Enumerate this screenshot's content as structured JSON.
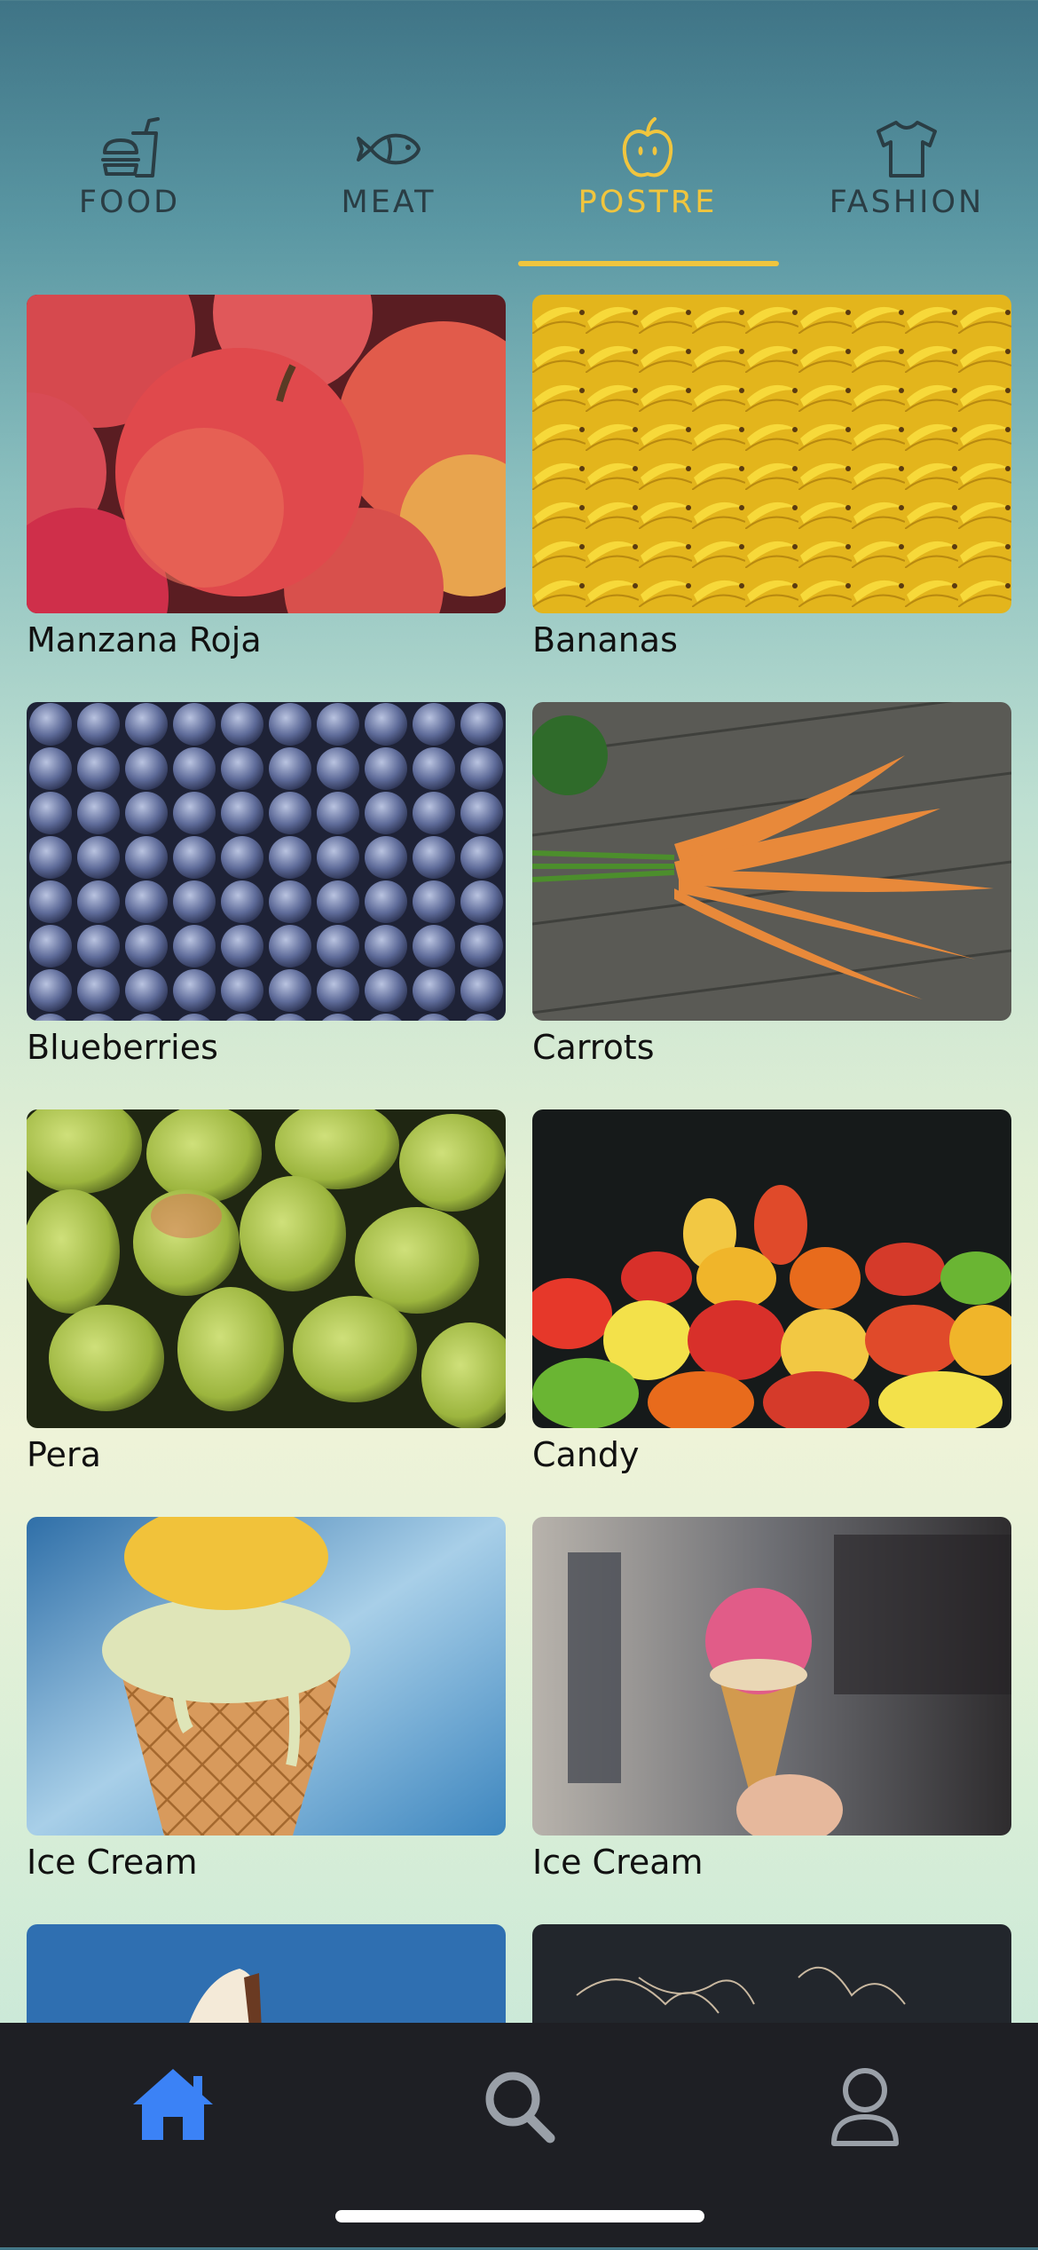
{
  "tabs": [
    {
      "label": "FOOD",
      "icon": "burger-drink-icon",
      "active": false
    },
    {
      "label": "MEAT",
      "icon": "fish-icon",
      "active": false
    },
    {
      "label": "POSTRE",
      "icon": "apple-icon",
      "active": true
    },
    {
      "label": "FASHION",
      "icon": "tshirt-icon",
      "active": false
    }
  ],
  "colors": {
    "accent": "#f0c53e",
    "tab_inactive": "#2a3d44",
    "nav_active": "#3b82f6",
    "nav_inactive": "#9aa0a8",
    "bottom_bar": "#1e1f24"
  },
  "products": [
    {
      "name": "Manzana Roja",
      "image": "red-apples-photo"
    },
    {
      "name": "Bananas",
      "image": "bananas-photo"
    },
    {
      "name": "Blueberries",
      "image": "blueberries-photo"
    },
    {
      "name": "Carrots",
      "image": "carrots-photo"
    },
    {
      "name": "Pera",
      "image": "pears-photo"
    },
    {
      "name": "Candy",
      "image": "gummy-bears-photo"
    },
    {
      "name": "Ice Cream",
      "image": "ice-cream-cone-photo"
    },
    {
      "name": "Ice Cream",
      "image": "pink-ice-cream-photo"
    },
    {
      "name": "",
      "image": "ice-cream-photo"
    },
    {
      "name": "",
      "image": "dark-photo"
    }
  ],
  "bottom_nav": [
    {
      "icon": "home-icon",
      "active": true
    },
    {
      "icon": "search-icon",
      "active": false
    },
    {
      "icon": "profile-icon",
      "active": false
    }
  ]
}
